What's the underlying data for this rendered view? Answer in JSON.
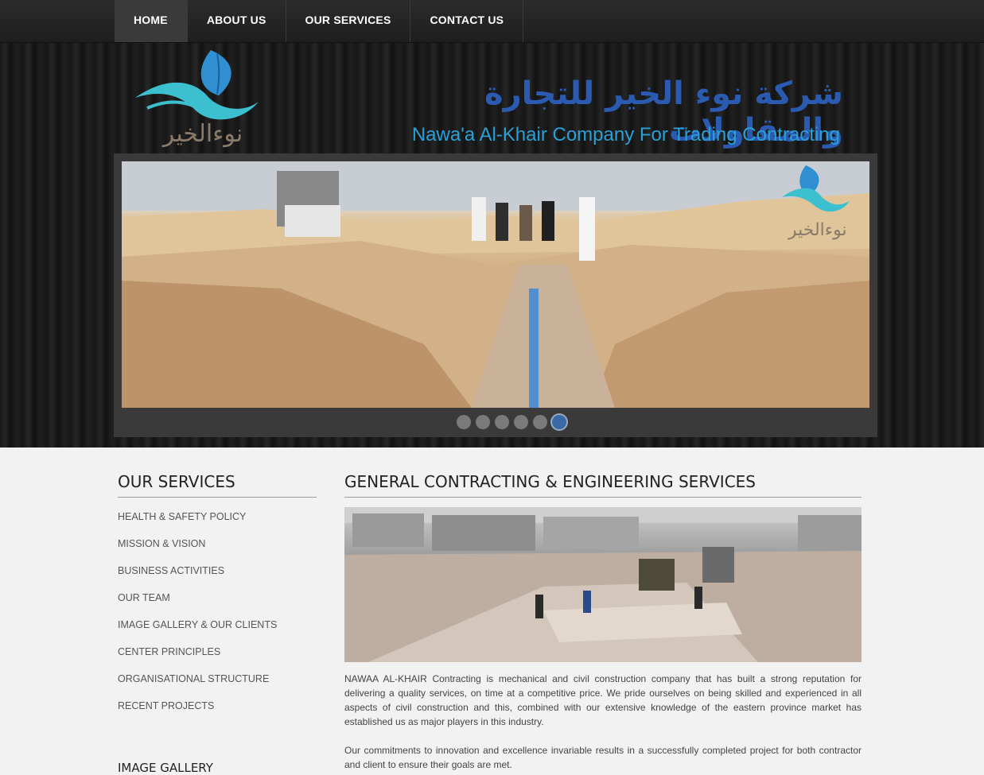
{
  "nav": {
    "items": [
      {
        "label": "HOME"
      },
      {
        "label": "ABOUT US"
      },
      {
        "label": "OUR SERVICES"
      },
      {
        "label": "CONTACT US"
      }
    ]
  },
  "header": {
    "logo_text": "نوءالخير",
    "title_ar": "شركة نوء الخير للتجارة والمقاولات",
    "title_en": "Nawa'a Al-Khair Company For Trading Contracting",
    "slider_logo_text": "نوءالخير",
    "slide_count": 6,
    "active_slide": 6
  },
  "sidebar": {
    "title": "OUR SERVICES",
    "links": [
      {
        "label": "HEALTH & SAFETY POLICY"
      },
      {
        "label": "MISSION & VISION"
      },
      {
        "label": "BUSINESS ACTIVITIES"
      },
      {
        "label": "OUR TEAM"
      },
      {
        "label": "IMAGE GALLERY & OUR CLIENTS"
      },
      {
        "label": "CENTER PRINCIPLES"
      },
      {
        "label": "ORGANISATIONAL STRUCTURE"
      },
      {
        "label": "RECENT PROJECTS"
      }
    ],
    "subtitle": "IMAGE GALLERY"
  },
  "main": {
    "title": "GENERAL CONTRACTING & ENGINEERING SERVICES",
    "paragraph1": "NAWAA AL-KHAIR Contracting is mechanical and civil construction company that has built a strong reputation for delivering a quality services, on time at a competitive price. We pride ourselves on being skilled and experienced in all aspects of civil construction and this, combined with our extensive knowledge of the eastern province market has established us as major players in this industry.",
    "paragraph2": "Our commitments to innovation and excellence invariable results in a successfully completed project for both contractor and client to ensure their goals are met."
  },
  "colors": {
    "nav_bg": "#222222",
    "title_ar": "#2a5bb0",
    "title_en": "#2aa0d8",
    "active_dot": "#3a6aa5"
  }
}
